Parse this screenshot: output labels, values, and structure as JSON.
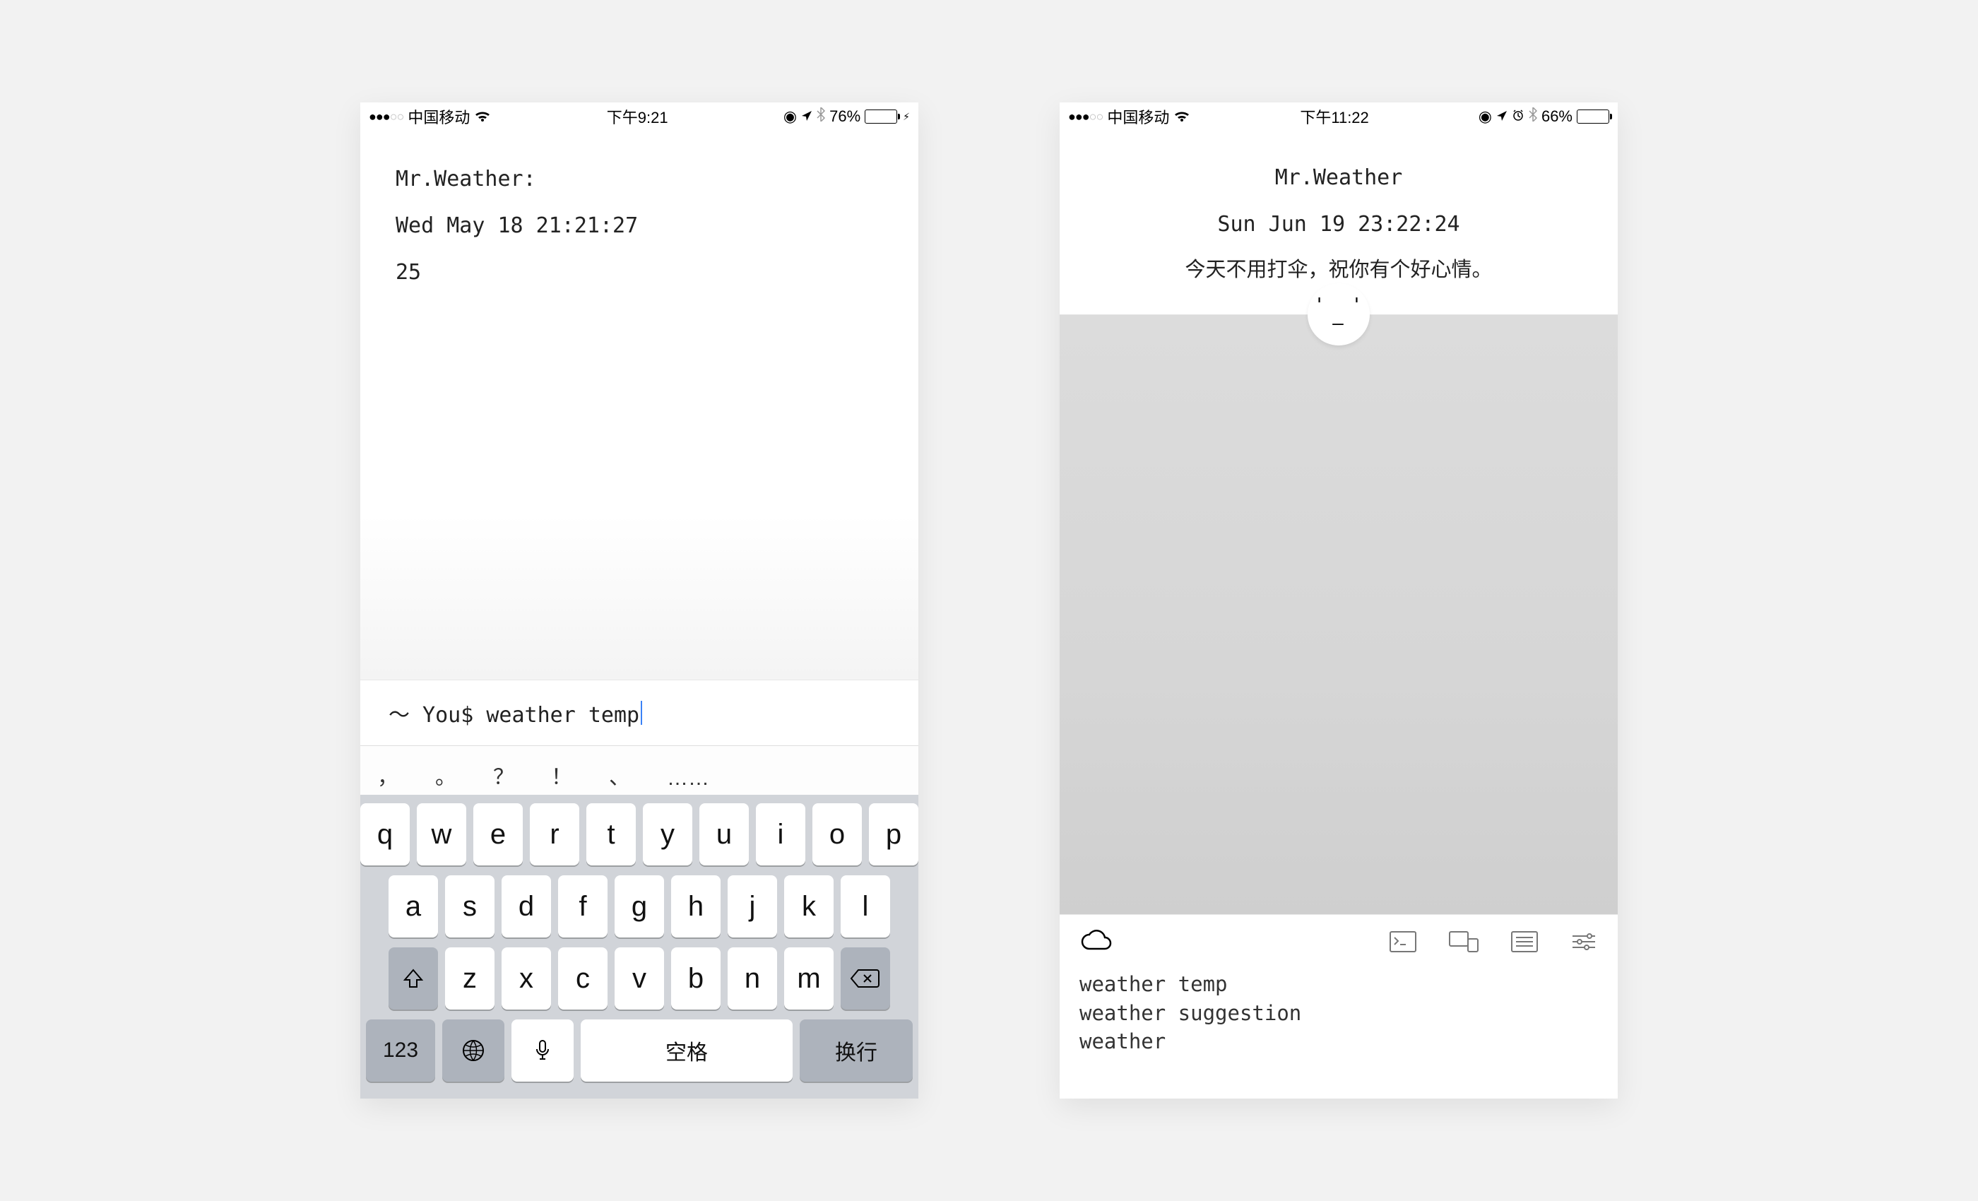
{
  "screen1": {
    "status": {
      "carrier": "中国移动",
      "time": "下午9:21",
      "battery_pct": "76%"
    },
    "terminal": {
      "line1": "Mr.Weather:",
      "line2": "Wed May 18 21:21:27",
      "line3": "25"
    },
    "prompt": "～ You$ weather temp",
    "suggestions": [
      "，",
      "。",
      "？",
      "！",
      "、",
      "……"
    ],
    "keyboard": {
      "row1": [
        "q",
        "w",
        "e",
        "r",
        "t",
        "y",
        "u",
        "i",
        "o",
        "p"
      ],
      "row2": [
        "a",
        "s",
        "d",
        "f",
        "g",
        "h",
        "j",
        "k",
        "l"
      ],
      "row3": [
        "z",
        "x",
        "c",
        "v",
        "b",
        "n",
        "m"
      ],
      "num": "123",
      "space": "空格",
      "return": "换行"
    }
  },
  "screen2": {
    "status": {
      "carrier": "中国移动",
      "time": "下午11:22",
      "battery_pct": "66%"
    },
    "header": {
      "title": "Mr.Weather",
      "datetime": "Sun Jun 19 23:22:24",
      "message": "今天不用打伞，祝你有个好心情。"
    },
    "commands": {
      "c1": "weather temp",
      "c2": "weather suggestion",
      "c3": "weather"
    }
  }
}
